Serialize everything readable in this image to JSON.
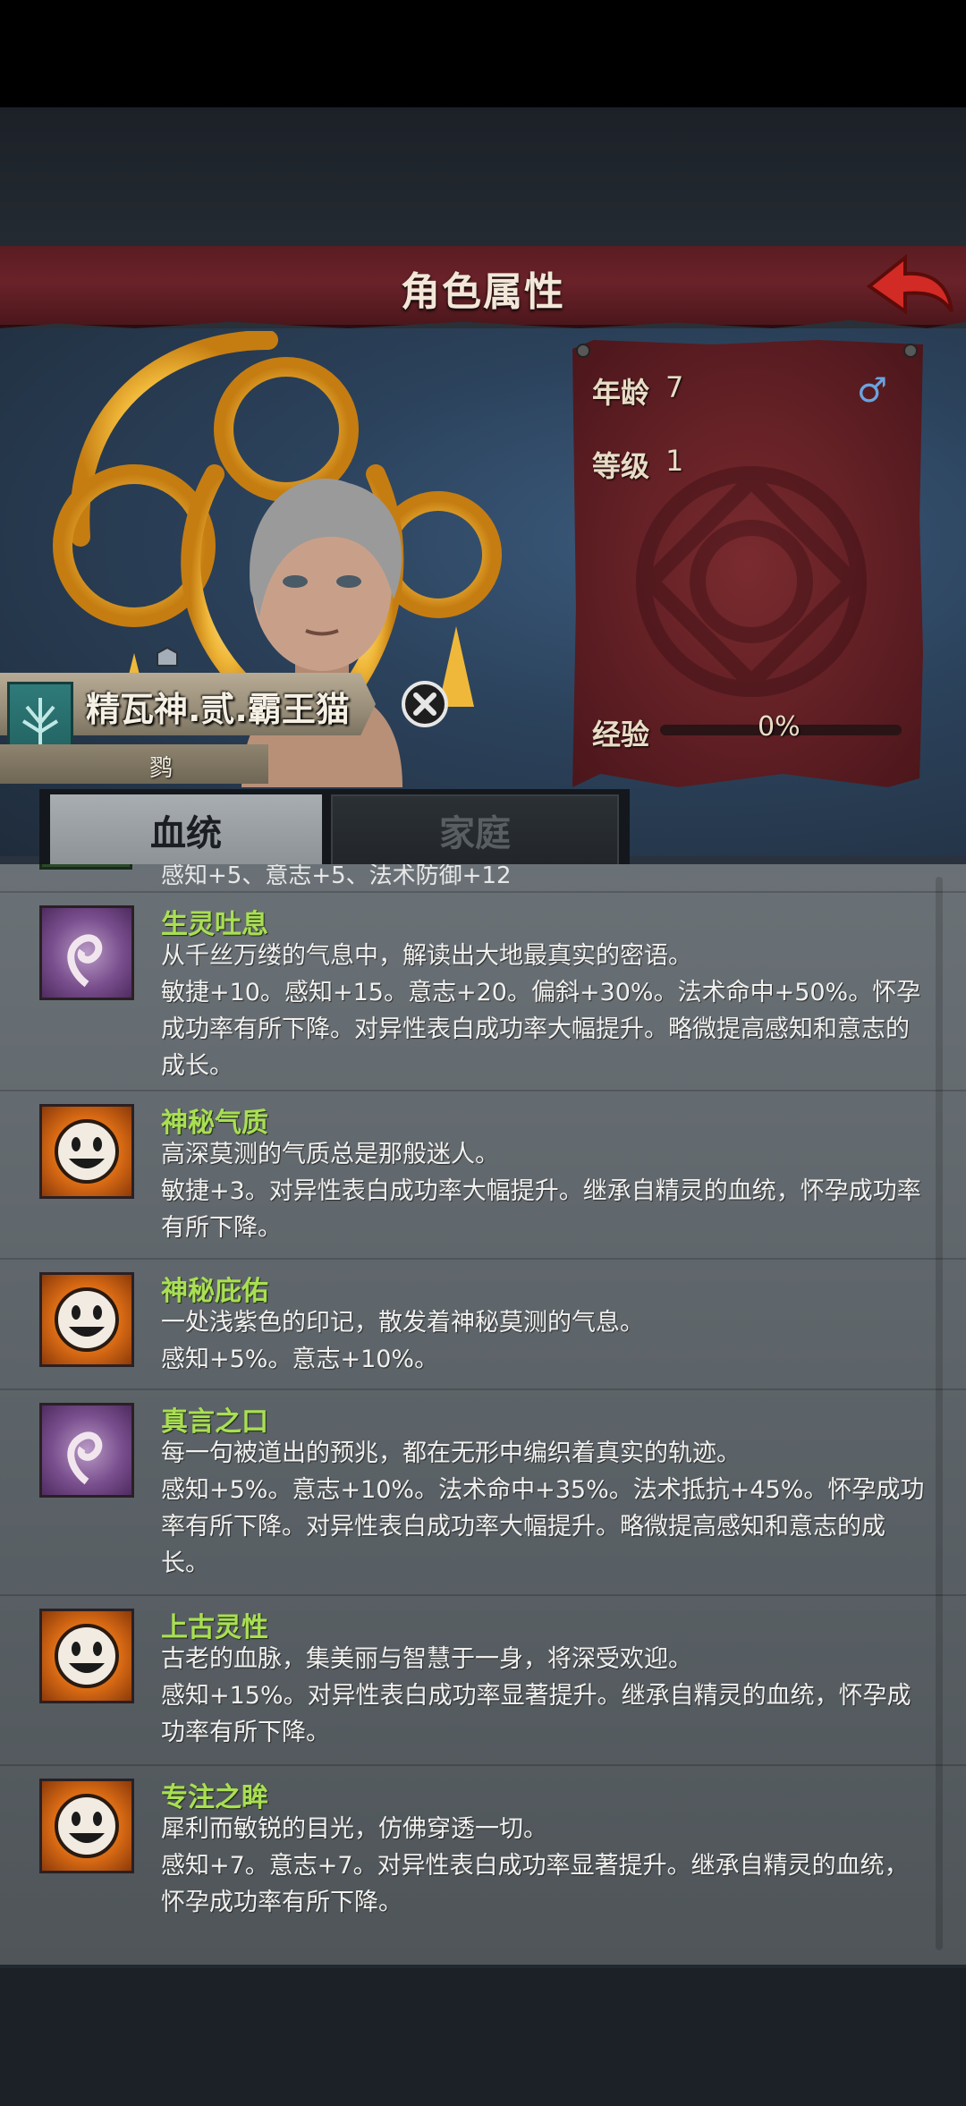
{
  "header": {
    "title": "角色属性"
  },
  "character": {
    "name": "精瓦神.贰.霸王猫",
    "title": "鹨"
  },
  "stats": {
    "age_label": "年龄",
    "age_value": "7",
    "level_label": "等级",
    "level_value": "1",
    "exp_label": "经验",
    "exp_value": "0%",
    "exp_fraction": 0.0,
    "gender": "♂"
  },
  "tabs": [
    {
      "label": "血统",
      "active": true
    },
    {
      "label": "家庭",
      "active": false
    }
  ],
  "partial_row": "感知+5、意志+5、法术防御+12",
  "traits": [
    {
      "name": "生灵吐息",
      "icon": "spiral-icon",
      "desc": "从千丝万缕的气息中，解读出大地最真实的密语。",
      "effect": "敏捷+10。感知+15。意志+20。偏斜+30%。法术命中+50%。怀孕成功率有所下降。对异性表白成功率大幅提升。略微提高感知和意志的成长。"
    },
    {
      "name": "神秘气质",
      "icon": "smile-icon",
      "desc": "高深莫测的气质总是那般迷人。",
      "effect": "敏捷+3。对异性表白成功率大幅提升。继承自精灵的血统，怀孕成功率有所下降。"
    },
    {
      "name": "神秘庇佑",
      "icon": "smile-icon",
      "desc": "一处浅紫色的印记，散发着神秘莫测的气息。",
      "effect": "感知+5%。意志+10%。"
    },
    {
      "name": "真言之口",
      "icon": "spiral-icon",
      "desc": "每一句被道出的预兆，都在无形中编织着真实的轨迹。",
      "effect": "感知+5%。意志+10%。法术命中+35%。法术抵抗+45%。怀孕成功率有所下降。对异性表白成功率大幅提升。略微提高感知和意志的成长。"
    },
    {
      "name": "上古灵性",
      "icon": "smile-icon",
      "desc": "古老的血脉，集美丽与智慧于一身，将深受欢迎。",
      "effect": "感知+15%。对异性表白成功率显著提升。继承自精灵的血统，怀孕成功率有所下降。"
    },
    {
      "name": "专注之眸",
      "icon": "smile-icon",
      "desc": "犀利而敏锐的目光，仿佛穿透一切。",
      "effect": "感知+7。意志+7。对异性表白成功率显著提升。继承自精灵的血统，怀孕成功率有所下降。"
    }
  ]
}
